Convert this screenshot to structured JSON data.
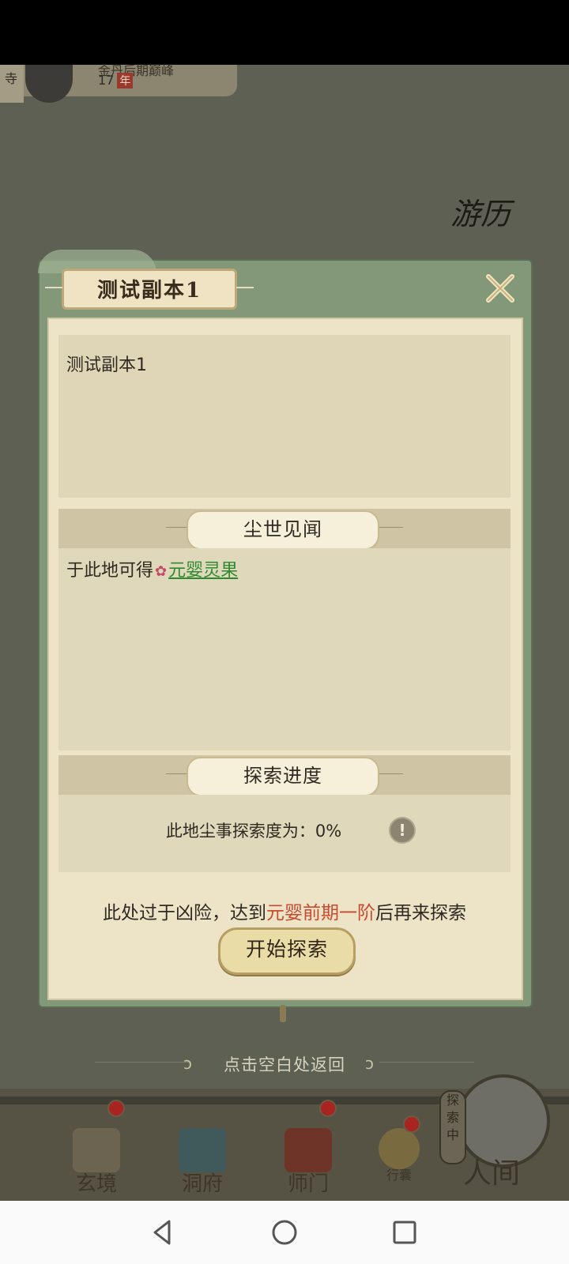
{
  "background": {
    "temple_label": "寺",
    "profile_title": "金丹后期巅峰",
    "profile_years": "17",
    "profile_year_unit": "年",
    "youli_label": "游历"
  },
  "dialog": {
    "title": "测试副本1",
    "description": "测试副本1",
    "section_rewards": "尘世见闻",
    "reward_prefix": "于此地可得",
    "reward_item": "元婴灵果",
    "section_progress": "探索进度",
    "progress_text": "此地尘事探索度为：0%",
    "info_icon": "!",
    "warning_prefix": "此处过于凶险，达到",
    "warning_realm": "元婴前期一阶",
    "warning_suffix": "后再来探索",
    "start_button": "开始探索"
  },
  "hint": "点击空白处返回",
  "bottom_nav": {
    "items": [
      {
        "label": "玄境",
        "icon": "scroll-icon"
      },
      {
        "label": "洞府",
        "icon": "pavilion-icon"
      },
      {
        "label": "师门",
        "icon": "banner-icon"
      },
      {
        "label": "行囊",
        "icon": "bag-icon"
      }
    ],
    "explore_tag": "探索中",
    "renjian": "人间"
  },
  "colors": {
    "reward_link": "#2d8a31",
    "warning_realm": "#c94a2f",
    "dialog_frame": "#829878"
  }
}
